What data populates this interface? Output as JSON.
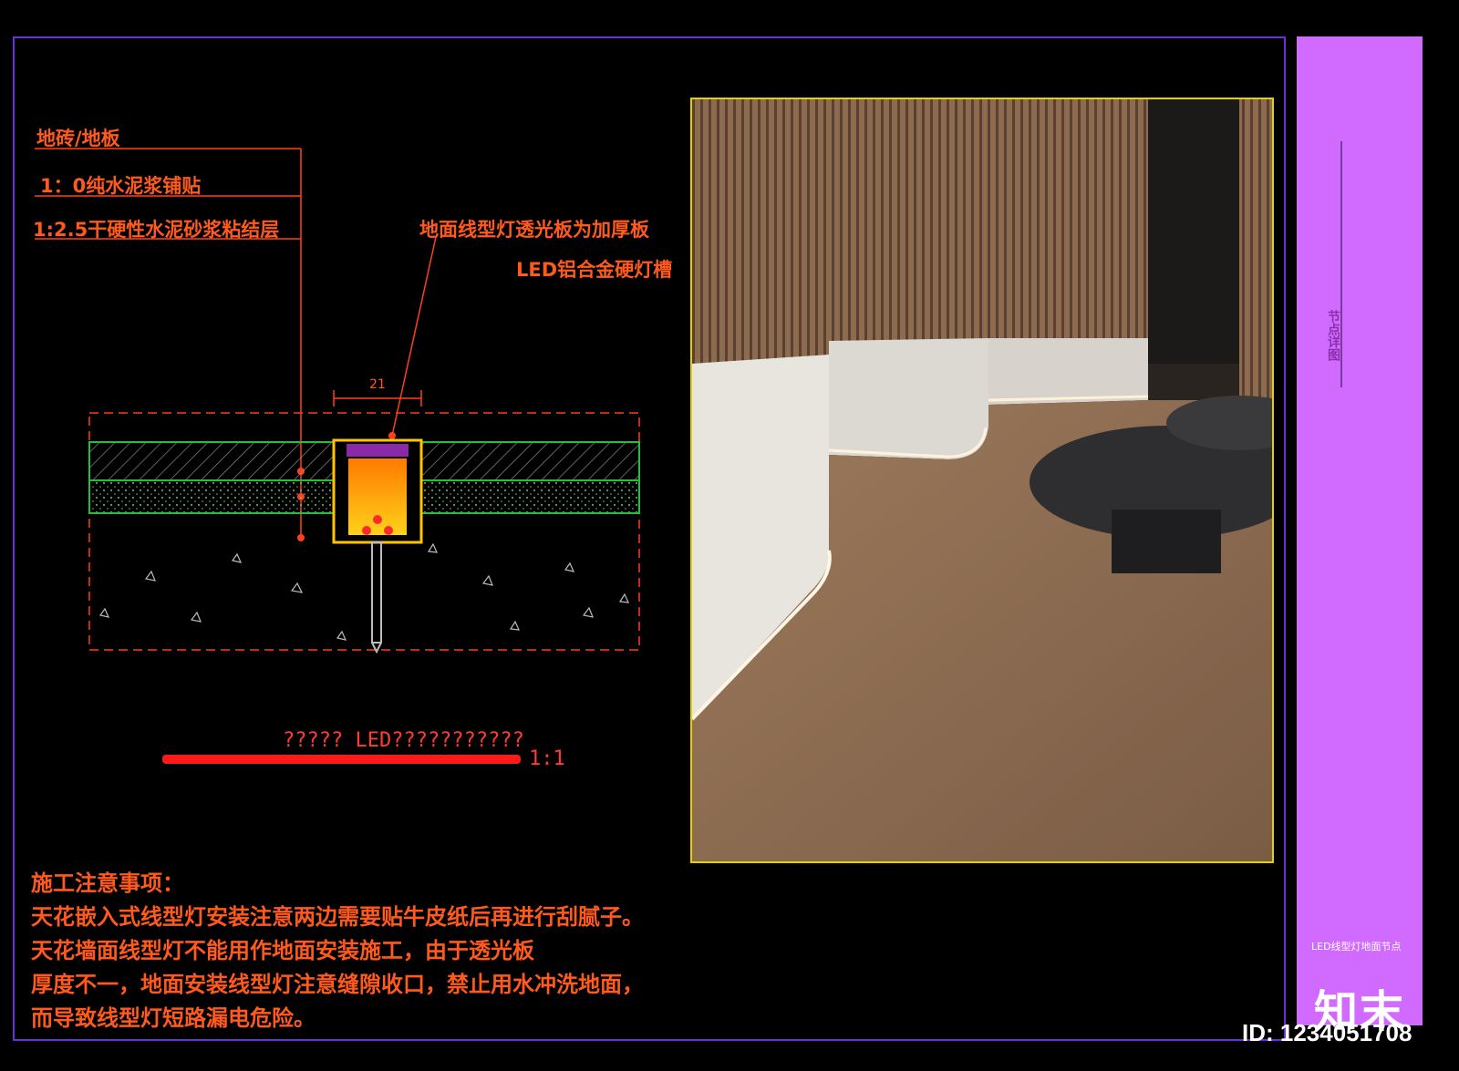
{
  "drawing": {
    "layers": [
      "地砖/地板",
      "1：0纯水泥浆铺贴",
      "1:2.5干硬性水泥砂浆粘结层"
    ],
    "callout_top": "地面线型灯透光板为加厚板",
    "callout_bottom": "LED铝合金硬灯槽",
    "dimension": "21",
    "scale_title": "????? LED???????????",
    "scale_ratio": "1:1"
  },
  "notes": {
    "heading": "施工注意事项：",
    "lines": [
      "天花嵌入式线型灯安装注意两边需要贴牛皮纸后再进行刮腻子。",
      "天花墙面线型灯不能用作地面安装施工，由于透光板",
      "厚度不一，地面安装线型灯注意缝隙收口，禁止用水冲洗地面，",
      "而导致线型灯短路漏电危险。"
    ]
  },
  "titleblock": {
    "vertical_text": "节点详图",
    "small_text": "LED线型灯地面节点",
    "logo": "知末"
  },
  "id_label": "ID: 1234051708",
  "colors": {
    "frame": "#6a2fd8",
    "titleblock": "#d16bff",
    "text": "#ff5a1e",
    "hatch_green": "#22c03a",
    "photo_border": "#e6d000",
    "fixture": "#ffc400"
  }
}
